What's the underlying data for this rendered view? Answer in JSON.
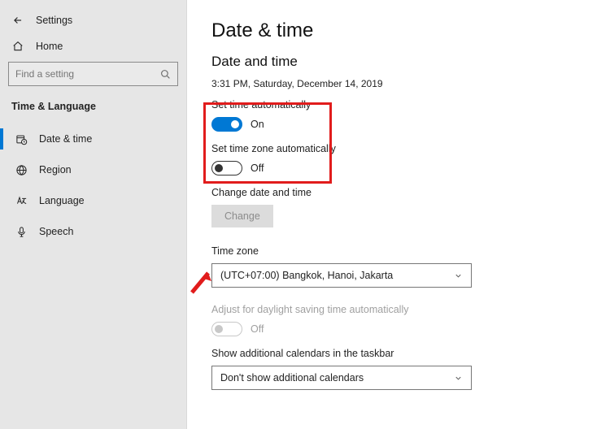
{
  "window": {
    "title": "Settings"
  },
  "sidebar": {
    "home": "Home",
    "search_placeholder": "Find a setting",
    "section": "Time & Language",
    "items": [
      {
        "label": "Date & time"
      },
      {
        "label": "Region"
      },
      {
        "label": "Language"
      },
      {
        "label": "Speech"
      }
    ]
  },
  "page": {
    "title": "Date & time",
    "subtitle": "Date and time",
    "current": "3:31 PM, Saturday, December 14, 2019",
    "set_time_auto": {
      "label": "Set time automatically",
      "value": "On"
    },
    "set_tz_auto": {
      "label": "Set time zone automatically",
      "value": "Off"
    },
    "change_dt": {
      "label": "Change date and time",
      "button": "Change"
    },
    "timezone": {
      "label": "Time zone",
      "value": "(UTC+07:00) Bangkok, Hanoi, Jakarta"
    },
    "dst": {
      "label": "Adjust for daylight saving time automatically",
      "value": "Off"
    },
    "additional_cal": {
      "label": "Show additional calendars in the taskbar",
      "value": "Don't show additional calendars"
    }
  }
}
